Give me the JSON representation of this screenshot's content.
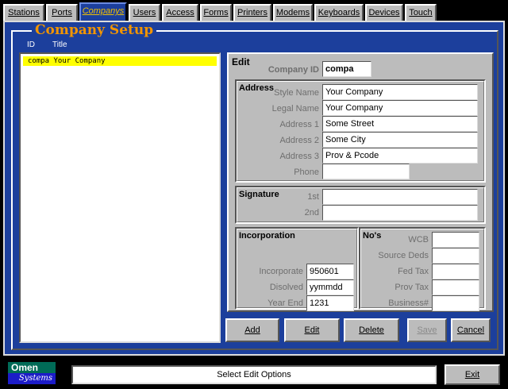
{
  "tabs": [
    {
      "label": "Stations",
      "active": false
    },
    {
      "label": "Ports",
      "active": false
    },
    {
      "label": "Companys",
      "active": true
    },
    {
      "label": "Users",
      "active": false
    },
    {
      "label": "Access",
      "active": false
    },
    {
      "label": "Forms",
      "active": false
    },
    {
      "label": "Printers",
      "active": false
    },
    {
      "label": "Modems",
      "active": false
    },
    {
      "label": "Keyboards",
      "active": false
    },
    {
      "label": "Devices",
      "active": false
    },
    {
      "label": "Touch",
      "active": false
    }
  ],
  "page_title": "Company Setup",
  "list": {
    "columns": [
      "ID",
      "Title"
    ],
    "rows": [
      {
        "id": "compa",
        "title": "Your Company"
      }
    ]
  },
  "edit": {
    "heading": "Edit",
    "company_id_label": "Company ID",
    "company_id": "compa",
    "address": {
      "heading": "Address",
      "style_name_label": "Style Name",
      "style_name": "Your Company",
      "legal_name_label": "Legal Name",
      "legal_name": "Your Company",
      "address1_label": "Address 1",
      "address1": "Some Street",
      "address2_label": "Address 2",
      "address2": "Some City",
      "address3_label": "Address 3",
      "address3": "Prov & Pcode",
      "phone_label": "Phone",
      "phone": ""
    },
    "signature": {
      "heading": "Signature",
      "first_label": "1st",
      "first": "",
      "second_label": "2nd",
      "second": ""
    },
    "incorporation": {
      "heading": "Incorporation",
      "incorporate_label": "Incorporate",
      "incorporate": "950601",
      "disolved_label": "Disolved",
      "disolved": "yymmdd",
      "year_end_label": "Year End",
      "year_end": "1231"
    },
    "numbers": {
      "heading": "No's",
      "wcb_label": "WCB",
      "wcb": "",
      "source_deds_label": "Source Deds",
      "source_deds": "",
      "fed_tax_label": "Fed Tax",
      "fed_tax": "",
      "prov_tax_label": "Prov Tax",
      "prov_tax": "",
      "business_label": "Business#",
      "business": ""
    }
  },
  "buttons": {
    "add": "Add",
    "edit": "Edit",
    "delete": "Delete",
    "save": "Save",
    "cancel": "Cancel",
    "exit": "Exit"
  },
  "status_text": "Select Edit Options",
  "logo": {
    "line1": "Omen",
    "line2": "Systems"
  },
  "colors": {
    "frame_blue": "#1c3f9c",
    "title_orange": "#f29500",
    "active_tab_text": "#f2c000",
    "selection_yellow": "#ffff00",
    "panel_gray": "#bcbcbc"
  }
}
